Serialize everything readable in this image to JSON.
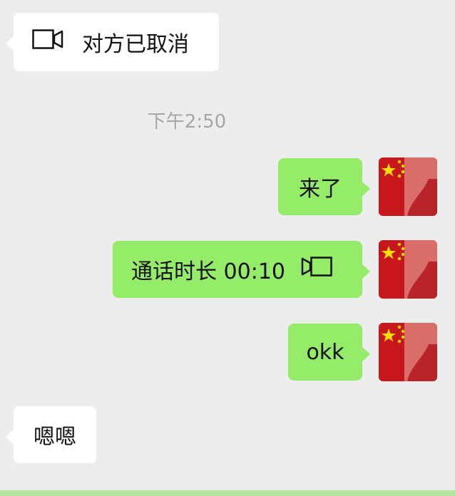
{
  "messages": {
    "cancelled_call": {
      "text": "对方已取消",
      "icon": "video-call-icon"
    },
    "timestamp": "下午2:50",
    "came": {
      "text": "来了"
    },
    "call_duration": {
      "text": "通话时长 00:10",
      "icon": "video-call-icon"
    },
    "okk": {
      "text": "okk"
    },
    "enen": {
      "text": "嗯嗯"
    }
  },
  "colors": {
    "background": "#ededed",
    "incoming_bubble": "#ffffff",
    "outgoing_bubble": "#95ec69",
    "timestamp": "#a6a6a6"
  }
}
